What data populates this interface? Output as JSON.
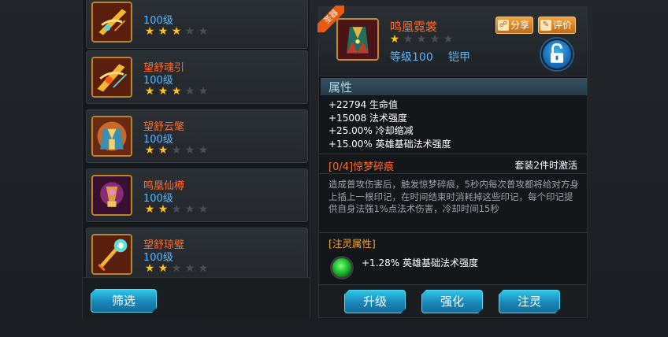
{
  "colors": {
    "name_orange": "#ff6a2a",
    "level_blue": "#58b6ff",
    "star_gold": "#ffc21c",
    "button_cyan": "#1a86b8",
    "section_title": "#a9dcf2"
  },
  "equipment_list": {
    "items": [
      {
        "name": "",
        "level": "100级",
        "stars": 3,
        "max_stars": 5,
        "icon": "golden-bow-icon"
      },
      {
        "name": "望舒魂引",
        "level": "100级",
        "stars": 3,
        "max_stars": 5,
        "icon": "golden-bow-icon"
      },
      {
        "name": "望舒云氅",
        "level": "100级",
        "stars": 2,
        "max_stars": 5,
        "icon": "robed-armor-icon"
      },
      {
        "name": "鸣凰仙樽",
        "level": "100级",
        "stars": 2,
        "max_stars": 5,
        "icon": "mystic-vessel-icon"
      },
      {
        "name": "望舒琼璧",
        "level": "100级",
        "stars": 2,
        "max_stars": 5,
        "icon": "jade-staff-icon"
      }
    ],
    "filter_label": "筛选"
  },
  "detail": {
    "badge": "圣器",
    "name": "鸣凰霓裳",
    "stars": 1,
    "max_stars": 5,
    "level": "等级100",
    "type": "铠甲",
    "share_label": "分享",
    "review_label": "评价",
    "lock_icon": "unlocked-padlock-icon",
    "attributes_title": "属性",
    "attributes": [
      "+22794 生命值",
      "+15008 法术强度",
      "+25.00% 冷却缩减",
      "+15.00% 英雄基础法术强度"
    ],
    "set_name": "[0/4]惊梦碎痕",
    "set_activation": "套装2件时激活",
    "set_description": "造成普攻伤害后，触发惊梦碎痕，5秒内每次普攻都将给对方身上插上一根印记，在时间结束时消耗掉这些印记，每个印记提供自身法强1%点法术伤害，冷却时间15秒",
    "soul_title": "[注灵属性]",
    "soul_attribute": "+1.28% 英雄基础法术强度",
    "actions": {
      "upgrade": "升级",
      "enhance": "强化",
      "infuse": "注灵"
    }
  }
}
